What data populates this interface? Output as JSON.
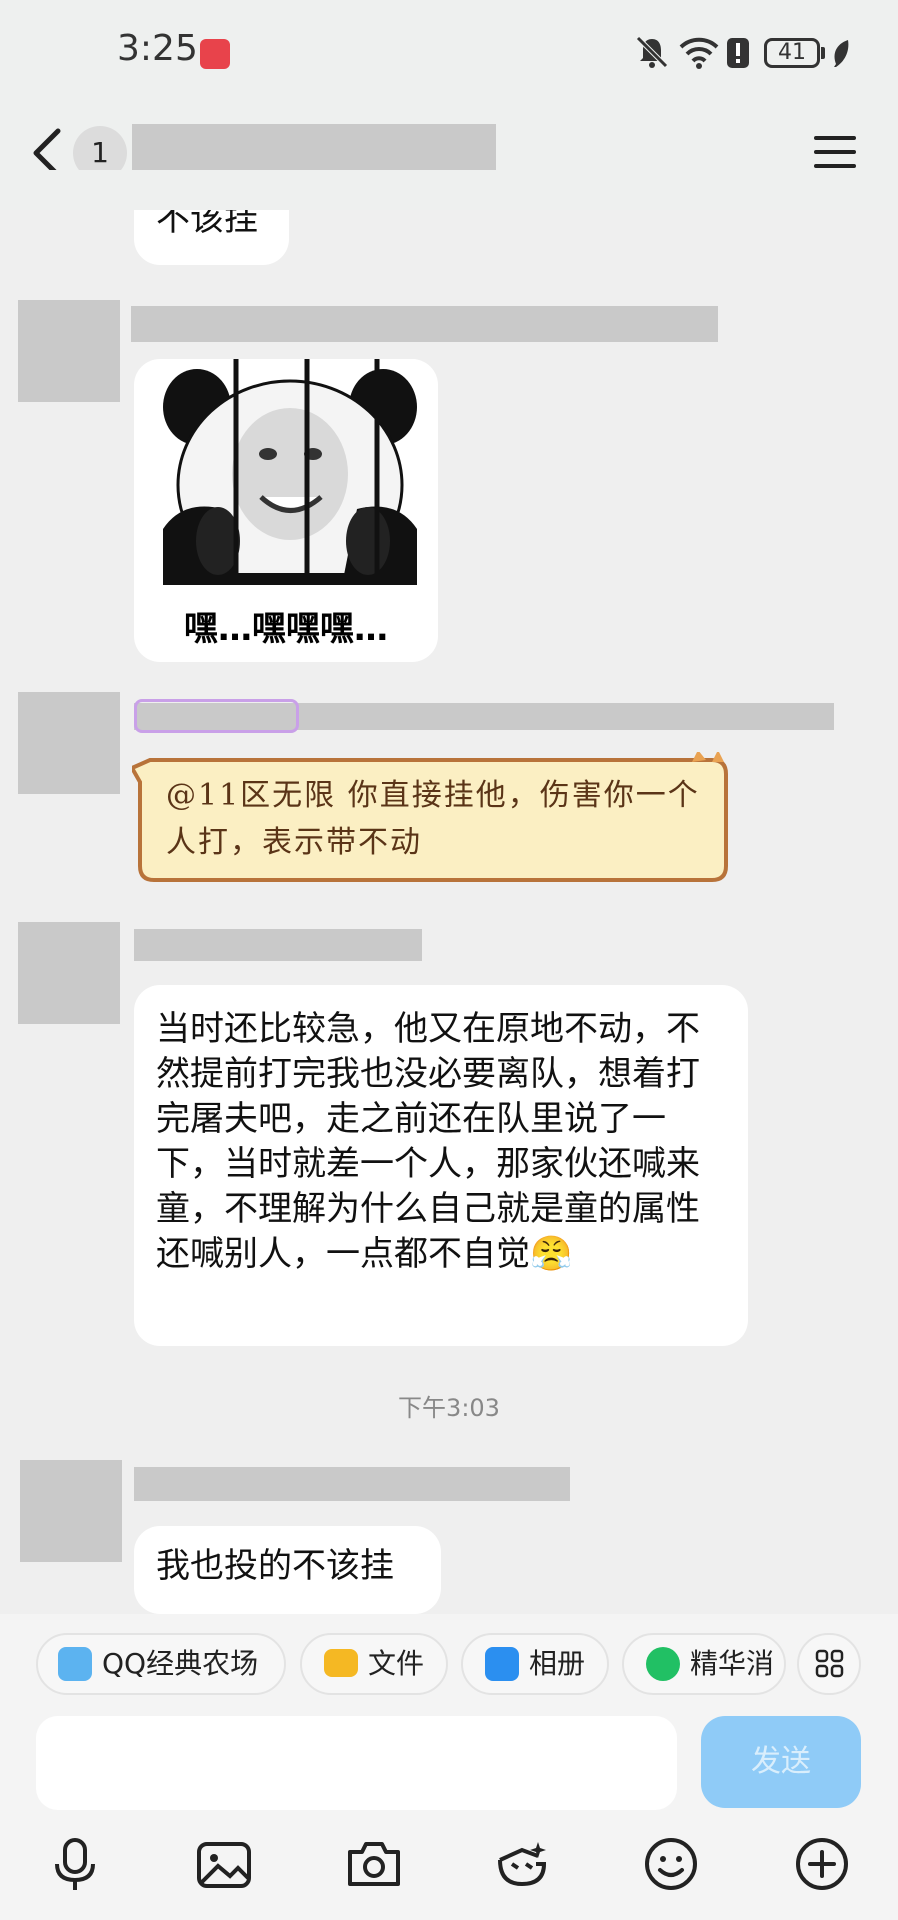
{
  "status_bar": {
    "time": "3:25",
    "app_icon": "huawei-appgallery-icon",
    "battery": "41",
    "icons": [
      "bell-muted-icon",
      "wifi-icon",
      "alert-icon",
      "battery-icon",
      "leaf-icon"
    ]
  },
  "header": {
    "unread_count": "1",
    "back_icon": "chevron-left-icon",
    "menu_icon": "hamburger-menu-icon"
  },
  "messages": {
    "partial_text": "不该挂",
    "sticker_caption": "嘿…嘿嘿嘿…",
    "special_text": "@11区无限 你直接挂他，伤害你一个人打，表示带不动",
    "long_text": "当时还比较急，他又在原地不动，不然提前打完我也没必要离队，想着打完屠夫吧，走之前还在队里说了一下，当时就差一个人，那家伙还喊来童，不理解为什么自己就是童的属性还喊别人，一点都不自觉",
    "long_emoji": "😤",
    "timestamp": "下午3:03",
    "last_text": "我也投的不该挂"
  },
  "quick_actions": [
    {
      "label": "QQ经典农场",
      "icon": "farm-game-icon"
    },
    {
      "label": "文件",
      "icon": "folder-icon"
    },
    {
      "label": "相册",
      "icon": "photo-album-icon"
    },
    {
      "label": "精华消",
      "icon": "star-badge-icon"
    }
  ],
  "input": {
    "placeholder": "",
    "send_label": "发送"
  },
  "toolbar": [
    "microphone-icon",
    "image-icon",
    "camera-icon",
    "sticker-face-icon",
    "emoji-icon",
    "plus-icon"
  ],
  "colors": {
    "send_button": "#8fcbf7",
    "chat_background": "#efefef",
    "special_bubble_fill": "#fbefc3",
    "special_bubble_border": "#b8733a"
  }
}
